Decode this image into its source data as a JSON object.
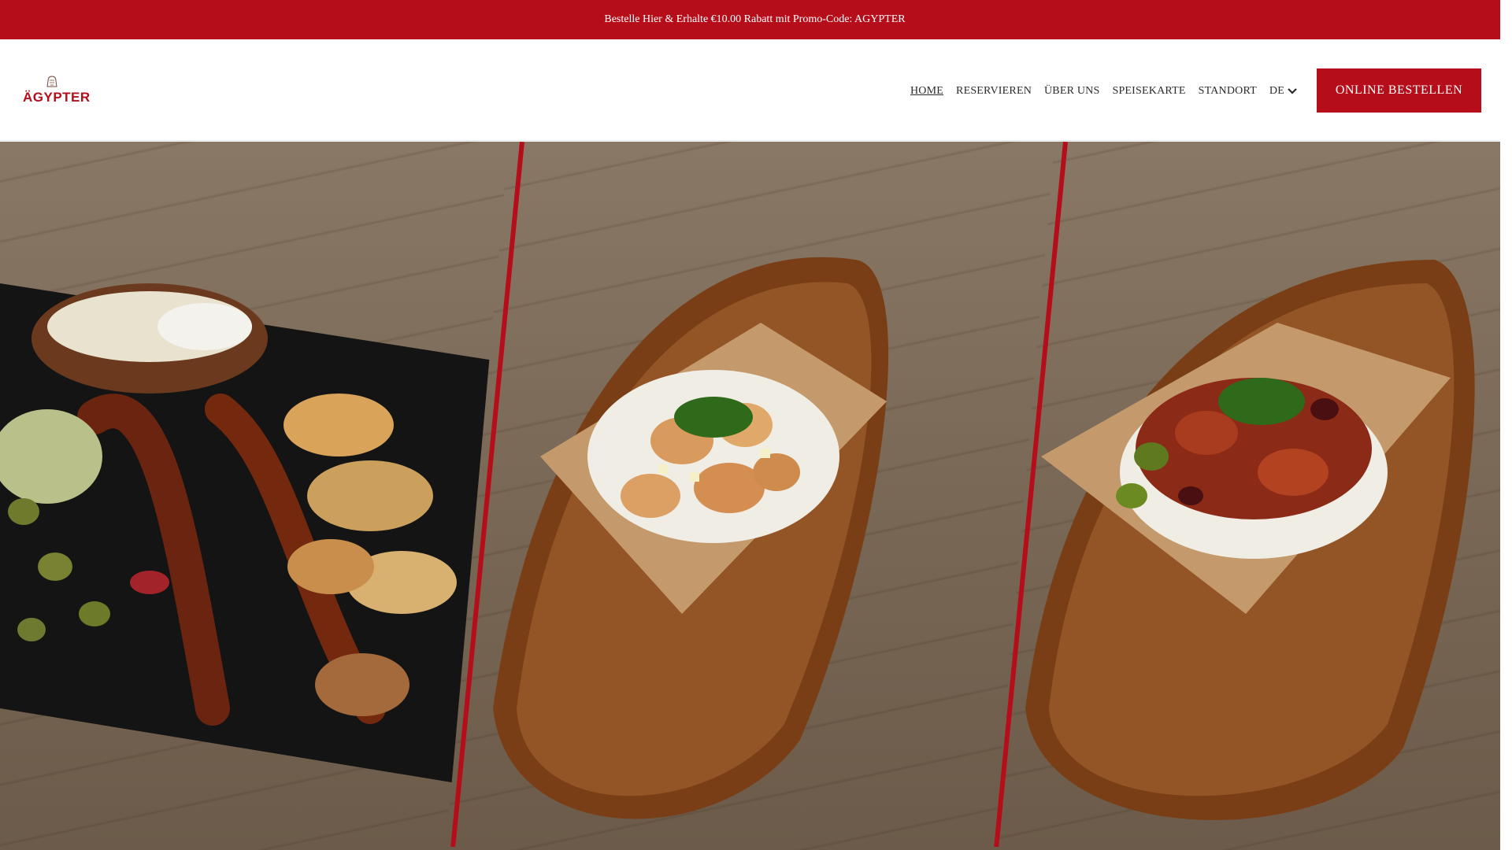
{
  "promo": {
    "text": "Bestelle Hier & Erhalte €10.00 Rabatt mit Promo-Code: AGYPTER"
  },
  "logo": {
    "small_text": "DER",
    "word": "ÄGYPTER"
  },
  "nav": {
    "items": [
      {
        "label": "HOME",
        "active": true
      },
      {
        "label": "RESERVIEREN"
      },
      {
        "label": "ÜBER UNS"
      },
      {
        "label": "SPEISEKARTE"
      },
      {
        "label": "STANDORT"
      }
    ],
    "language": "DE",
    "cta": "ONLINE BESTELLEN"
  },
  "colors": {
    "brand_red": "#b50e1a",
    "nav_text": "#2a2a2a"
  },
  "icons": {
    "language_toggle": "chevron-down-icon",
    "logo_crest": "pharaoh-head-icon"
  },
  "hero": {
    "panels": [
      {
        "description": "Platter with sausages, potatoes, salad, olives and dips"
      },
      {
        "description": "Chicken pieces on rice with herbs in paper tray"
      },
      {
        "description": "Spicy meat with beans and jalapeños on rice in paper tray"
      }
    ]
  }
}
